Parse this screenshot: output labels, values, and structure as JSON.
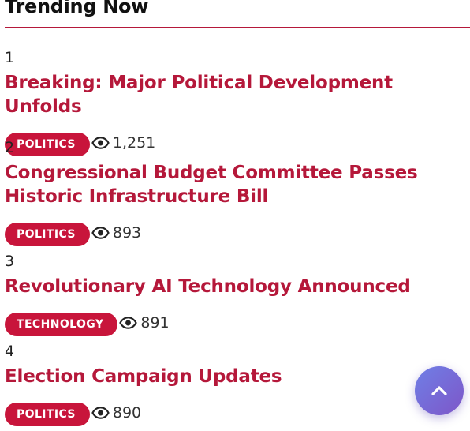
{
  "section": {
    "title": "Trending Now"
  },
  "items": [
    {
      "rank": "1",
      "title": "Breaking: Major Political Development Unfolds",
      "category": "POLITICS",
      "views": "1,251"
    },
    {
      "rank": "2",
      "title": "Congressional Budget Committee Passes Historic Infrastructure Bill",
      "category": "POLITICS",
      "views": "893"
    },
    {
      "rank": "3",
      "title": "Revolutionary AI Technology Announced",
      "category": "TECHNOLOGY",
      "views": "891"
    },
    {
      "rank": "4",
      "title": "Election Campaign Updates",
      "category": "POLITICS",
      "views": "890"
    }
  ],
  "icons": {
    "views": "eye-icon",
    "scroll_top": "chevron-up-icon"
  },
  "colors": {
    "accent": "#b5183a",
    "badge": "#c8153b",
    "scroll_button_start": "#6f7fe6",
    "scroll_button_end": "#7e56c8"
  }
}
